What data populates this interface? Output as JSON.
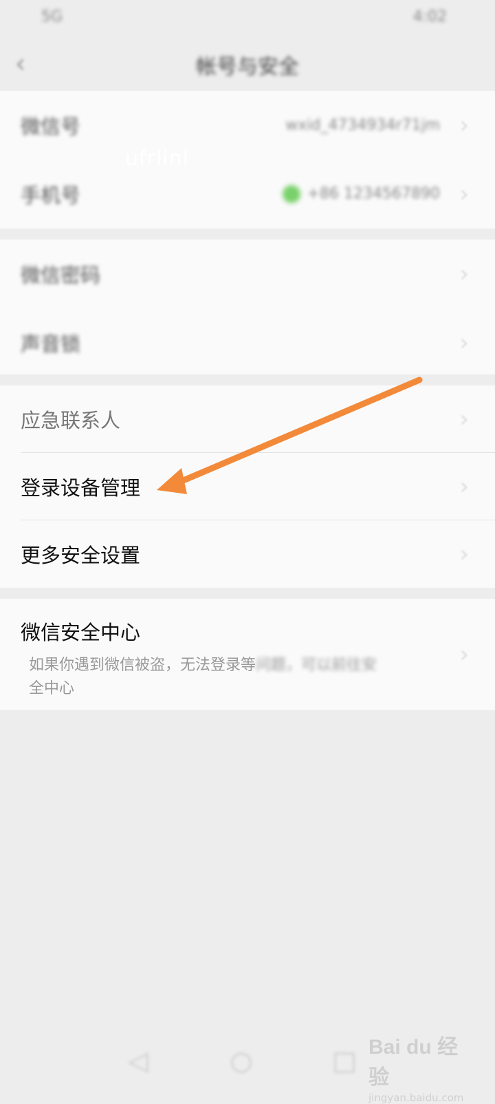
{
  "status_bar": {
    "left": "5G",
    "right": "4:02"
  },
  "top_bar": {
    "back_icon": "chevron-left-icon",
    "title": "帐号与安全"
  },
  "group1": {
    "rows": [
      {
        "label": "微信号",
        "value": "wxid_4734934r71jm"
      },
      {
        "label": "手机号",
        "value": "+86 1234567890"
      }
    ],
    "overlay_text": "ufrlinl"
  },
  "group2": {
    "rows": [
      {
        "label": "微信密码"
      },
      {
        "label": "声音锁"
      }
    ]
  },
  "group3": {
    "rows": [
      {
        "label": "应急联系人"
      },
      {
        "label": "登录设备管理"
      },
      {
        "label": "更多安全设置"
      }
    ]
  },
  "group4": {
    "title": "微信安全中心",
    "desc_visible": "如果你遇到微信被盗，无法登录等",
    "desc_blur": "问题，可以前往安",
    "desc_line2": "全中心"
  },
  "annotation": {
    "arrow_color": "#f28a3a"
  },
  "watermark": {
    "logo_text": "Bai du 经验",
    "site": "jingyan.baidu.com"
  }
}
